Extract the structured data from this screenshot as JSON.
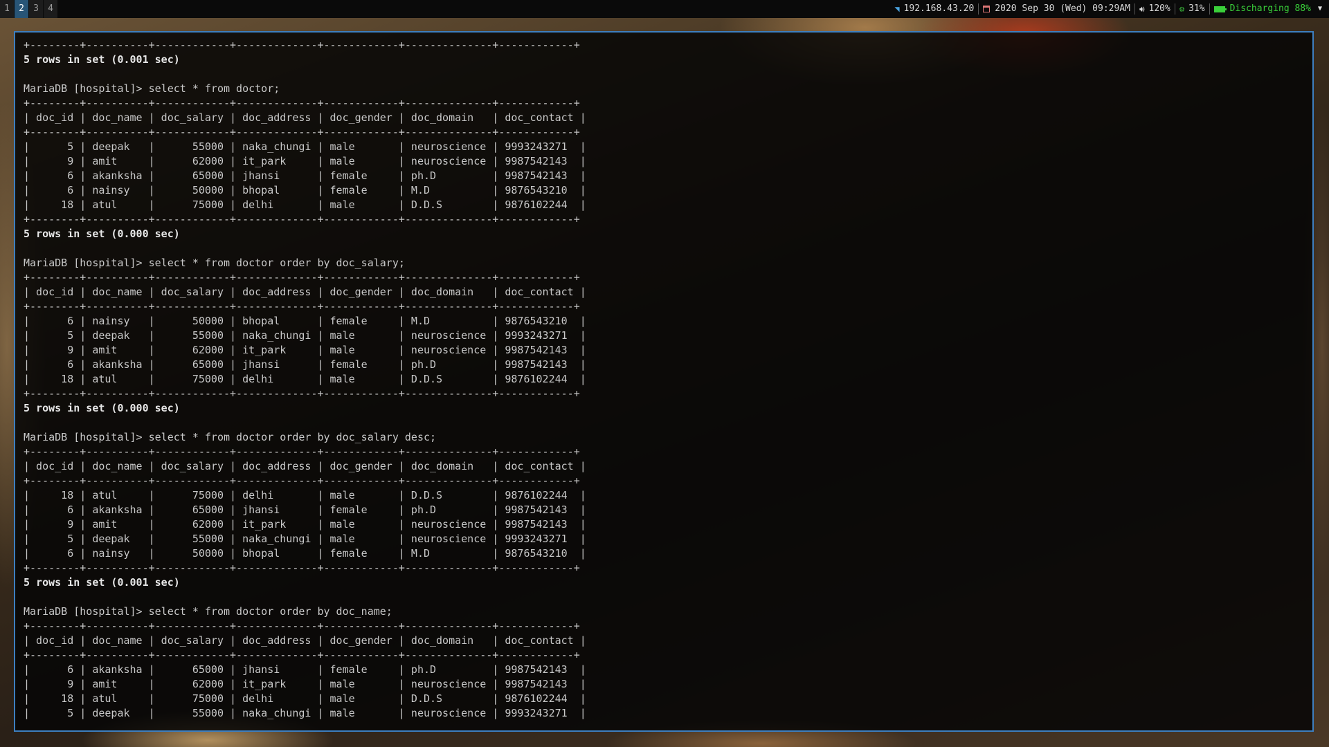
{
  "topbar": {
    "workspaces": [
      "1",
      "2",
      "3",
      "4"
    ],
    "active_workspace": "2",
    "network": {
      "icon": "wifi-icon",
      "ip": "192.168.43.20"
    },
    "datetime": {
      "icon": "calendar-icon",
      "text": "2020 Sep 30 (Wed) 09:29AM"
    },
    "volume": {
      "icon": "speaker-icon",
      "text": "120%"
    },
    "cpu": {
      "icon": "cpu-icon",
      "text": "31%"
    },
    "battery": {
      "icon": "battery-icon",
      "text": "Discharging 88%"
    },
    "colors": {
      "active_workspace": "#285577",
      "battery": "#3ad03a",
      "wifi": "#4aa3e0"
    }
  },
  "terminal": {
    "border_color": "#3d7fc0",
    "lines": [
      "+--------+----------+------------+-------------+------------+--------------+------------+",
      "5 rows in set (0.001 sec)",
      "",
      "MariaDB [hospital]> select * from doctor;",
      "+--------+----------+------------+-------------+------------+--------------+------------+",
      "| doc_id | doc_name | doc_salary | doc_address | doc_gender | doc_domain   | doc_contact |",
      "+--------+----------+------------+-------------+------------+--------------+------------+",
      "|      5 | deepak   |      55000 | naka_chungi | male       | neuroscience | 9993243271  |",
      "|      9 | amit     |      62000 | it_park     | male       | neuroscience | 9987542143  |",
      "|      6 | akanksha |      65000 | jhansi      | female     | ph.D         | 9987542143  |",
      "|      6 | nainsy   |      50000 | bhopal      | female     | M.D          | 9876543210  |",
      "|     18 | atul     |      75000 | delhi       | male       | D.D.S        | 9876102244  |",
      "+--------+----------+------------+-------------+------------+--------------+------------+",
      "5 rows in set (0.000 sec)",
      "",
      "MariaDB [hospital]> select * from doctor order by doc_salary;",
      "+--------+----------+------------+-------------+------------+--------------+------------+",
      "| doc_id | doc_name | doc_salary | doc_address | doc_gender | doc_domain   | doc_contact |",
      "+--------+----------+------------+-------------+------------+--------------+------------+",
      "|      6 | nainsy   |      50000 | bhopal      | female     | M.D          | 9876543210  |",
      "|      5 | deepak   |      55000 | naka_chungi | male       | neuroscience | 9993243271  |",
      "|      9 | amit     |      62000 | it_park     | male       | neuroscience | 9987542143  |",
      "|      6 | akanksha |      65000 | jhansi      | female     | ph.D         | 9987542143  |",
      "|     18 | atul     |      75000 | delhi       | male       | D.D.S        | 9876102244  |",
      "+--------+----------+------------+-------------+------------+--------------+------------+",
      "5 rows in set (0.000 sec)",
      "",
      "MariaDB [hospital]> select * from doctor order by doc_salary desc;",
      "+--------+----------+------------+-------------+------------+--------------+------------+",
      "| doc_id | doc_name | doc_salary | doc_address | doc_gender | doc_domain   | doc_contact |",
      "+--------+----------+------------+-------------+------------+--------------+------------+",
      "|     18 | atul     |      75000 | delhi       | male       | D.D.S        | 9876102244  |",
      "|      6 | akanksha |      65000 | jhansi      | female     | ph.D         | 9987542143  |",
      "|      9 | amit     |      62000 | it_park     | male       | neuroscience | 9987542143  |",
      "|      5 | deepak   |      55000 | naka_chungi | male       | neuroscience | 9993243271  |",
      "|      6 | nainsy   |      50000 | bhopal      | female     | M.D          | 9876543210  |",
      "+--------+----------+------------+-------------+------------+--------------+------------+",
      "5 rows in set (0.001 sec)",
      "",
      "MariaDB [hospital]> select * from doctor order by doc_name;",
      "+--------+----------+------------+-------------+------------+--------------+------------+",
      "| doc_id | doc_name | doc_salary | doc_address | doc_gender | doc_domain   | doc_contact |",
      "+--------+----------+------------+-------------+------------+--------------+------------+",
      "|      6 | akanksha |      65000 | jhansi      | female     | ph.D         | 9987542143  |",
      "|      9 | amit     |      62000 | it_park     | male       | neuroscience | 9987542143  |",
      "|     18 | atul     |      75000 | delhi       | male       | D.D.S        | 9876102244  |",
      "|      5 | deepak   |      55000 | naka_chungi | male       | neuroscience | 9993243271  |"
    ]
  }
}
